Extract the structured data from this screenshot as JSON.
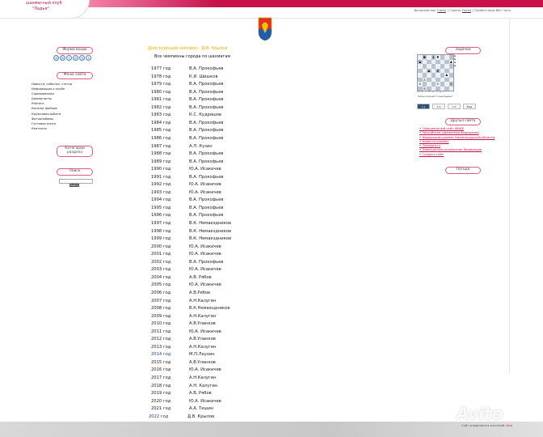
{
  "header": {
    "logo_line1": "шахматный клуб",
    "logo_line2": "\"Ладья\"",
    "user_prefix": "Вы вошли как",
    "user_link": "Гость",
    "sep1": "|",
    "groups_prefix": "Группа",
    "groups_link": "Гости",
    "sep2": "|",
    "greeting": "Приветствую Вас Гость"
  },
  "left": {
    "login_form_title": "Форма входа",
    "social_icons": [
      "Я",
      "В",
      "f",
      "G",
      "О",
      "t"
    ],
    "menu_title": "Меню сайта",
    "menu_items": [
      "Новости, события, статьи",
      "Информация о клубе",
      "Соревнования",
      "Шахматисты",
      "Рейтинг",
      "Каталог файлов",
      "Кружковая работа",
      "Фотоальбомы",
      "Гостевая книга",
      "Контакты"
    ],
    "categories_title": "Категории раздела",
    "search_title": "Поиск",
    "search_button": "Найти"
  },
  "main": {
    "current_champion": "Действующий чемпион - Д.В. Крылов",
    "list_title": "Все чемпионы города по шахматам",
    "champions": [
      {
        "year": "1977 год",
        "name": "В.А. Прокофьев"
      },
      {
        "year": "1978 год",
        "name": "К.И. Шишков"
      },
      {
        "year": "1979 год",
        "name": "В.А. Прокофьев"
      },
      {
        "year": "1980 год",
        "name": "В.А. Прокофьев"
      },
      {
        "year": "1981 год",
        "name": "В.А. Прокофьев"
      },
      {
        "year": "1982 год",
        "name": "В.А. Прокофьев"
      },
      {
        "year": "1983 год",
        "name": "К.С. Кудряшов"
      },
      {
        "year": "1984 год",
        "name": "В.А. Прокофьев"
      },
      {
        "year": "1985 год",
        "name": "В.А. Прокофьев"
      },
      {
        "year": "1986 год",
        "name": "В.А. Прокофьев"
      },
      {
        "year": "1987 год",
        "name": "А.Л. Кузин"
      },
      {
        "year": "1988 год",
        "name": "В.А. Прокофьев"
      },
      {
        "year": "1989 год",
        "name": "В.А. Прокофьев"
      },
      {
        "year": "1990 год",
        "name": "Ю.А. Исакичев"
      },
      {
        "year": "1991 год",
        "name": "В.А. Прокофьев"
      },
      {
        "year": "1992 год",
        "name": "Ю.А. Исакичев"
      },
      {
        "year": "1993 год",
        "name": "Ю.А. Исакичев"
      },
      {
        "year": "1994 год",
        "name": "В.А. Прокофьев"
      },
      {
        "year": "1995 год",
        "name": "В.А. Прокофьев"
      },
      {
        "year": "1996 год",
        "name": "В.А. Прокофьев"
      },
      {
        "year": "1997 год",
        "name": "В.К. Немаездников"
      },
      {
        "year": "1998 год",
        "name": "В.К. Немаездников"
      },
      {
        "year": "1999 год",
        "name": "В.К. Немаездников"
      },
      {
        "year": "2000 год",
        "name": "Ю.А. Исакичев"
      },
      {
        "year": "2001 год",
        "name": "Ю.А. Исакичев"
      },
      {
        "year": "2002 год",
        "name": "В.А. Прокофьев"
      },
      {
        "year": "2003 год",
        "name": "Ю.А. Исакичев"
      },
      {
        "year": "2004 год",
        "name": "А.В. Рябов"
      },
      {
        "year": "2005 год",
        "name": "Ю.А. Исакичев"
      },
      {
        "year": "2006 год",
        "name": "А.В.Рябов"
      },
      {
        "year": "2007 год",
        "name": "А.Н.Калугин"
      },
      {
        "year": "2008 год",
        "name": "В.К.Немаездников"
      },
      {
        "year": "2009 год",
        "name": "А.Н.Калугин"
      },
      {
        "year": "2010 год",
        "name": "А.В.Уланков"
      },
      {
        "year": "2011 год",
        "name": "Ю.А. Исакичев"
      },
      {
        "year": "2012 год",
        "name": "А.В.Уланков"
      },
      {
        "year": "2013 год",
        "name": "А.Н.Калугин"
      },
      {
        "year": "2014 год",
        "name": "М.П.Леухин"
      },
      {
        "year": "2015 год",
        "name": "А.В.Уланков"
      },
      {
        "year": "2016 год",
        "name": "Ю.А. Исакичев"
      },
      {
        "year": "2017 год",
        "name": "А.Н.Калугин"
      },
      {
        "year": "2018 год",
        "name": "А.Н. Калугин"
      },
      {
        "year": "2019 год",
        "name": "А.В. Рябов"
      },
      {
        "year": "2020 год",
        "name": "Ю.А. Исакичев"
      },
      {
        "year": "2021 год",
        "name": "А.А. Тишин"
      },
      {
        "year": "2022 год",
        "name": "Д.В. Крылов"
      }
    ]
  },
  "right": {
    "tasks_title": "Задачки",
    "board_rows": [
      [
        "",
        "♚",
        "",
        "♝",
        "♜",
        "",
        "",
        ""
      ],
      [
        "♟",
        "",
        "",
        "",
        "",
        "",
        "",
        "♟"
      ],
      [
        "",
        "",
        "",
        "",
        "",
        "",
        "",
        ""
      ],
      [
        "",
        "",
        "♟",
        "",
        "♛",
        "",
        "",
        ""
      ],
      [
        "",
        "",
        "",
        "",
        "",
        "",
        "♟",
        ""
      ],
      [
        "",
        "♙",
        "",
        "",
        "",
        "",
        "",
        ""
      ],
      [
        "♙",
        "",
        "",
        "",
        "♕",
        "",
        "",
        "♙"
      ],
      [
        "",
        "♔",
        "",
        "",
        "",
        "",
        "",
        ""
      ]
    ],
    "board_caption": "Белые начинают и выигрывают",
    "board_tabs": [
      "1.1",
      "1.2",
      "1.3",
      "Ещё"
    ],
    "friends_title": "Друзья сайта",
    "friends": [
      "Официальный сайт ФИДЕ",
      "Российская шахматная Федерация",
      "Федерация шахмат Нижегородской области",
      "Новости шахмат",
      "Chesspro.ru",
      "Электронная шахматная Федерация",
      "Создать сайт"
    ],
    "weather_title": "Погода"
  },
  "footer": {
    "powered_prefix": "Сайт управляется системой",
    "powered_link": "uCoz"
  },
  "watermark": "Avito",
  "colors": {
    "accent": "#c8104a",
    "champion_title": "#e8b400",
    "pill_border": "#e05a84"
  }
}
